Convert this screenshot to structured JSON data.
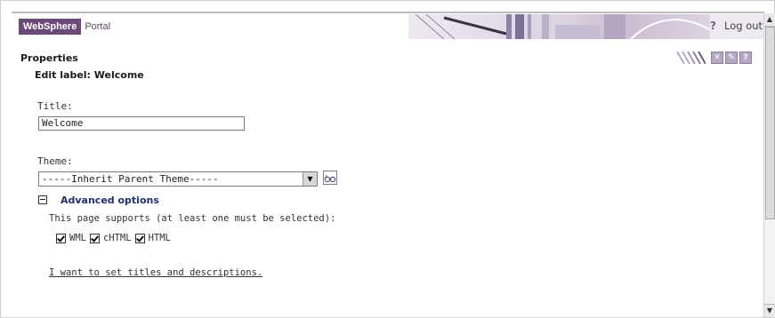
{
  "header": {
    "logo_brand": "WebSphere",
    "logo_product": "Portal",
    "help_glyph": "?",
    "logout_label": "Log out"
  },
  "page": {
    "section_title": "Properties",
    "edit_label": "Edit label: Welcome"
  },
  "form": {
    "title_label": "Title:",
    "title_value": "Welcome",
    "theme_label": "Theme:",
    "theme_selected": "-----Inherit Parent Theme-----",
    "advanced_label": "Advanced options",
    "supports_text": "This page supports (at least one must be selected):",
    "markups": [
      {
        "label": "WML",
        "checked": true
      },
      {
        "label": "cHTML",
        "checked": true
      },
      {
        "label": "HTML",
        "checked": true
      }
    ],
    "titles_link": "I want to set titles and descriptions."
  },
  "icons": {
    "help": "question-icon",
    "edit": "pencil-icon",
    "configure": "wrench-icon",
    "preview": "preview-icon",
    "collapse": "minus-box-icon",
    "dropdown": "chevron-down-icon"
  },
  "colors": {
    "brand": "#6b4a78",
    "link": "#1f2f6b",
    "banner": "#d9cfdd"
  }
}
